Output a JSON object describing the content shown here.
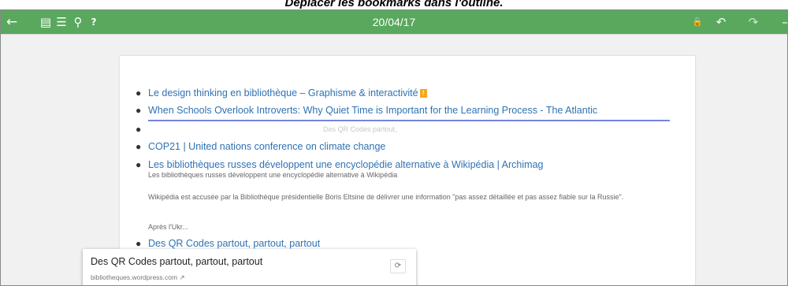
{
  "caption": "Déplacer les bookmarks dans l'outline.",
  "toolbar": {
    "back_icon": "←",
    "card_icon": "▤",
    "list_icon": "☰",
    "search_icon": "⚲",
    "help_icon": "?",
    "date": "20/04/17",
    "lock_icon": "🔒",
    "undo_icon": "↶",
    "redo_icon": "↷",
    "more_icon": "–"
  },
  "outline": {
    "items": [
      {
        "text": "Le design thinking en bibliothèque – Graphisme & interactivité",
        "badge": "!"
      },
      {
        "text": "When Schools Overlook Introverts: Why Quiet Time is Important for the Learning Process - The Atlantic"
      },
      {
        "text": ""
      },
      {
        "text": "COP21 | United nations conference on climate change"
      },
      {
        "text": "Les bibliothèques russes développent une encyclopédie alternative à Wikipédia | Archimag"
      },
      {
        "text": "Des QR Codes partout, partout, partout"
      }
    ],
    "ghost_text": "Des QR Codes partout,",
    "desc_1": "Les bibliothèques russes développent une encyclopédie alternative à Wikipédia",
    "desc_2": "Wikipédia est accusée par la Bibliothèque présidentielle Boris Eltsine de délivrer une information \"pas assez détaillée et pas assez fiable sur la Russie\".",
    "desc_3": "Après l'Ukr..."
  },
  "popup": {
    "title": "Des QR Codes partout, partout, partout",
    "url": "bibliotheques.wordpress.com",
    "link_icon": "↗",
    "refresh_icon": "⟳"
  }
}
